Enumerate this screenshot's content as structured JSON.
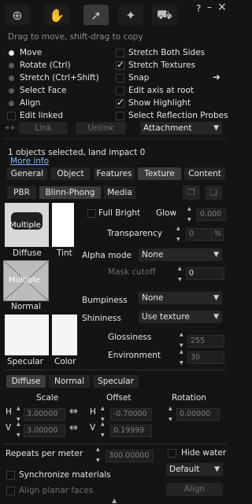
{
  "window": {
    "help": "?",
    "minimize": "–",
    "close": "×"
  },
  "tools": {
    "zoom_icon": "magnifier-icon",
    "move_icon": "grab-hand-icon",
    "edit_icon": "pointer-arrow-icon",
    "create_icon": "magic-wand-icon",
    "land_icon": "bulldozer-icon"
  },
  "hint": "Drag to move, shift-drag to copy",
  "modes": [
    {
      "label": "Move",
      "checked": true
    },
    {
      "label": "Rotate (Ctrl)",
      "checked": false
    },
    {
      "label": "Stretch (Ctrl+Shift)",
      "checked": false
    },
    {
      "label": "Select Face",
      "checked": false
    },
    {
      "label": "Align",
      "checked": false
    }
  ],
  "edit_linked": "Edit linked",
  "right_options": [
    {
      "label": "Stretch Both Sides",
      "checked": false
    },
    {
      "label": "Stretch Textures",
      "checked": true
    },
    {
      "label": "Snap",
      "checked": false
    },
    {
      "label": "Edit axis at root",
      "checked": false
    },
    {
      "label": "Show Highlight",
      "checked": true
    },
    {
      "label": "Select Reflection Probes",
      "checked": false
    }
  ],
  "link_label": "Link",
  "unlink_label": "Unlink",
  "attachment": "Attachment",
  "status": "1 objects selected, land impact 0",
  "more_info": "More info",
  "tabs": [
    "General",
    "Object",
    "Features",
    "Texture",
    "Content"
  ],
  "subtabs": [
    "PBR",
    "Blinn-Phong",
    "Media"
  ],
  "thumb_text": "Multiple",
  "labels": {
    "diffuse": "Diffuse",
    "tint": "Tint",
    "normal": "Normal",
    "specular": "Specular",
    "color": "Color"
  },
  "full_bright": "Full Bright",
  "glow": "Glow",
  "glow_val": "0.000",
  "transparency": "Transparency",
  "transparency_val": "0",
  "percent": "%",
  "alpha_mode": "Alpha mode",
  "alpha_mode_val": "None",
  "mask_cutoff": "Mask cutoff",
  "mask_cutoff_val": "0",
  "bumpiness": "Bumpiness",
  "bumpiness_val": "None",
  "shininess": "Shininess",
  "shininess_val": "Use texture",
  "glossiness": "Glossiness",
  "glossiness_val": "255",
  "environment": "Environment",
  "environment_val": "30",
  "map_tabs": [
    "Diffuse",
    "Normal",
    "Specular"
  ],
  "headers": {
    "scale": "Scale",
    "offset": "Offset",
    "rotation": "Rotation"
  },
  "h": "H",
  "v": "V",
  "scale_h": "3.00000",
  "scale_v": "3.00000",
  "offset_h": "-0.70000",
  "offset_v": "0.19999",
  "rotation_val": "0.00000",
  "repeats": "Repeats per meter",
  "repeats_val": "300.00000",
  "hide_water": "Hide water",
  "sync": "Synchronize materials",
  "default_val": "Default",
  "align_planar": "Align planar faces",
  "align_btn": "Align",
  "colors": {
    "bg": "#141414",
    "panel": "#242424",
    "accent": "#3c3c3c"
  }
}
